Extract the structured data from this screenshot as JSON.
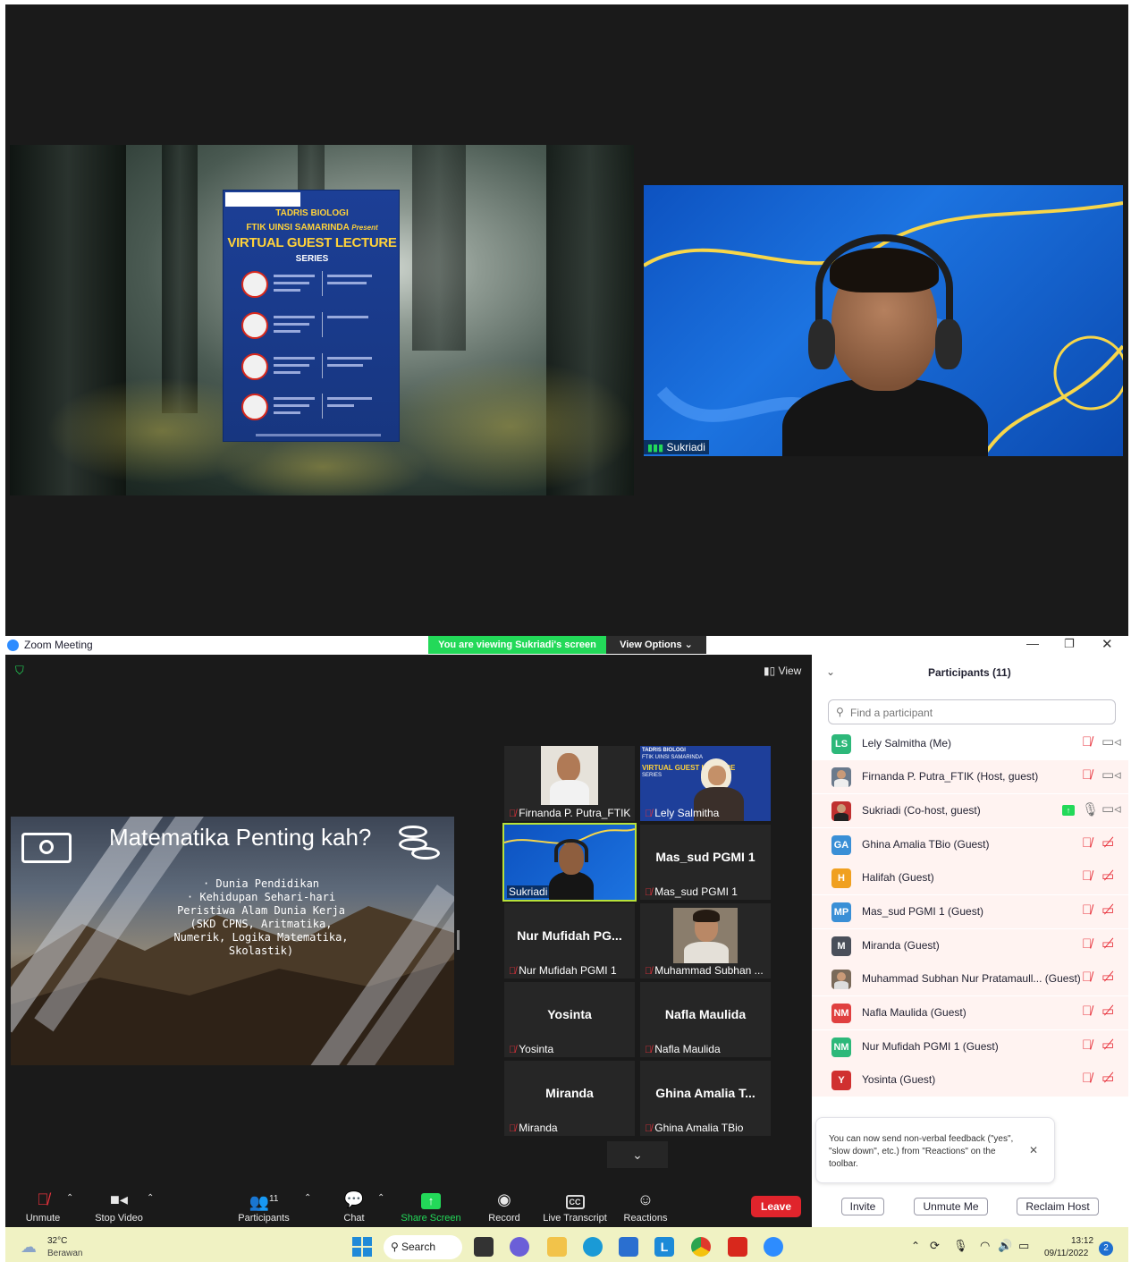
{
  "poster": {
    "title_line1": "TADRIS BIOLOGI",
    "title_line2": "FTIK UINSI SAMARINDA",
    "title_script": "Present",
    "title_line3": "VIRTUAL GUEST LECTURE",
    "title_line4": "SERIES"
  },
  "top_video": {
    "speaker_name": "Sukriadi"
  },
  "titlebar": {
    "app_name": "Zoom Meeting",
    "banner": "You are viewing Sukriadi's screen",
    "view_options": "View Options",
    "view_label": "View"
  },
  "slide": {
    "title": "Matematika Penting kah?",
    "bullets": [
      "Dunia Pendidikan",
      "Kehidupan Sehari-hari",
      "Peristiwa Alam Dunia Kerja",
      "(SKD CPNS, Aritmatika,",
      "Numerik, Logika Matematika,",
      "Skolastik)"
    ]
  },
  "tiles": [
    {
      "label": "Firnanda P. Putra_FTIK"
    },
    {
      "label": "Lely Salmitha"
    },
    {
      "label": "Sukriadi"
    },
    {
      "big": "Mas_sud PGMI 1",
      "label": "Mas_sud PGMI 1"
    },
    {
      "big": "Nur Mufidah PG...",
      "label": "Nur Mufidah PGMI 1"
    },
    {
      "label": "Muhammad Subhan ..."
    },
    {
      "big": "Yosinta",
      "label": "Yosinta"
    },
    {
      "big": "Nafla Maulida",
      "label": "Nafla Maulida"
    },
    {
      "big": "Miranda",
      "label": "Miranda"
    },
    {
      "big": "Ghina Amalia T...",
      "label": "Ghina Amalia TBio"
    }
  ],
  "tile_poster": {
    "line1": "TADRIS BIOLOGI",
    "line2": "FTIK UINSI SAMARINDA",
    "line3": "VIRTUAL GUEST LECTURE",
    "line4": "SERIES"
  },
  "toolbar": {
    "unmute": "Unmute",
    "stop_video": "Stop Video",
    "participants": "Participants",
    "participants_count": "11",
    "chat": "Chat",
    "share_screen": "Share Screen",
    "record": "Record",
    "live_transcript": "Live Transcript",
    "reactions": "Reactions",
    "leave": "Leave"
  },
  "panel": {
    "title": "Participants (11)",
    "search_placeholder": "Find a participant",
    "participants": [
      {
        "initials": "LS",
        "name": "Lely Salmitha (Me)",
        "color": "#2db87a"
      },
      {
        "initials": "",
        "name": "Firnanda P. Putra_FTIK (Host, guest)",
        "color": "#6b7a8c"
      },
      {
        "initials": "",
        "name": "Sukriadi (Co-host, guest)",
        "color": "#c03030"
      },
      {
        "initials": "GA",
        "name": "Ghina Amalia TBio (Guest)",
        "color": "#3a8fd6"
      },
      {
        "initials": "H",
        "name": "Halifah (Guest)",
        "color": "#f0a020"
      },
      {
        "initials": "MP",
        "name": "Mas_sud PGMI 1 (Guest)",
        "color": "#3a8fd6"
      },
      {
        "initials": "M",
        "name": "Miranda (Guest)",
        "color": "#4a4f5a"
      },
      {
        "initials": "",
        "name": "Muhammad Subhan Nur Pratamaull... (Guest)",
        "color": "#7a6a5a"
      },
      {
        "initials": "NM",
        "name": "Nafla Maulida (Guest)",
        "color": "#e04040"
      },
      {
        "initials": "NM",
        "name": "Nur Mufidah PGMI 1 (Guest)",
        "color": "#2db87a"
      },
      {
        "initials": "Y",
        "name": "Yosinta (Guest)",
        "color": "#d03030"
      }
    ],
    "tip": "You can now send non-verbal feedback (\"yes\", \"slow down\", etc.) from \"Reactions\" on the toolbar.",
    "invite": "Invite",
    "unmute_me": "Unmute Me",
    "reclaim_host": "Reclaim Host"
  },
  "taskbar": {
    "temperature": "32°C",
    "weather": "Berawan",
    "search": "Search",
    "time": "13:12",
    "date": "09/11/2022",
    "notification_count": "2"
  }
}
